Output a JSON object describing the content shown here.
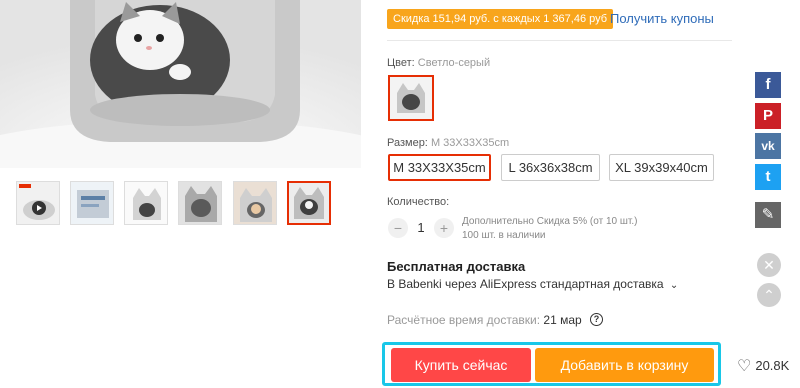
{
  "coupon": {
    "text": "Скидка 151,94 руб. с каждых 1 367,46 руб",
    "link": "Получить купоны",
    "color": "#f8a51c"
  },
  "color": {
    "label": "Цвет:",
    "value": "Светло-серый"
  },
  "size": {
    "label": "Размер:",
    "value": "M 33X33X35cm",
    "options": [
      "M 33X33X35cm",
      "L 36x36x38cm",
      "XL 39x39x40cm"
    ],
    "selected_index": 0
  },
  "quantity": {
    "label": "Количество:",
    "minus": "−",
    "value": "1",
    "plus": "+",
    "discount_note": "Дополнительно Скидка 5% (от 10 шт.)",
    "stock_note": "100 шт. в наличии"
  },
  "shipping": {
    "title": "Бесплатная доставка",
    "method": "В Babenki через AliExpress стандартная доставка",
    "eta_label": "Расчётное время доставки:",
    "eta_value": "21 мар",
    "help_icon": "?"
  },
  "actions": {
    "buy_now": "Купить сейчас",
    "add_to_cart": "Добавить в корзину",
    "wishlist_count": "20.8K",
    "buy_color": "#ff4747",
    "cart_color": "#ff9a0e"
  },
  "social": [
    {
      "name": "facebook-icon",
      "glyph": "f",
      "color": "#3b5998"
    },
    {
      "name": "pinterest-icon",
      "glyph": "P",
      "color": "#cb2027"
    },
    {
      "name": "vk-icon",
      "glyph": "vk",
      "color": "#4c75a3"
    },
    {
      "name": "twitter-icon",
      "glyph": "t",
      "color": "#1da1f2"
    },
    {
      "name": "edit-icon",
      "glyph": "✎",
      "color": "#666666"
    }
  ],
  "thumbnails": {
    "count": 6,
    "selected_index": 5
  }
}
